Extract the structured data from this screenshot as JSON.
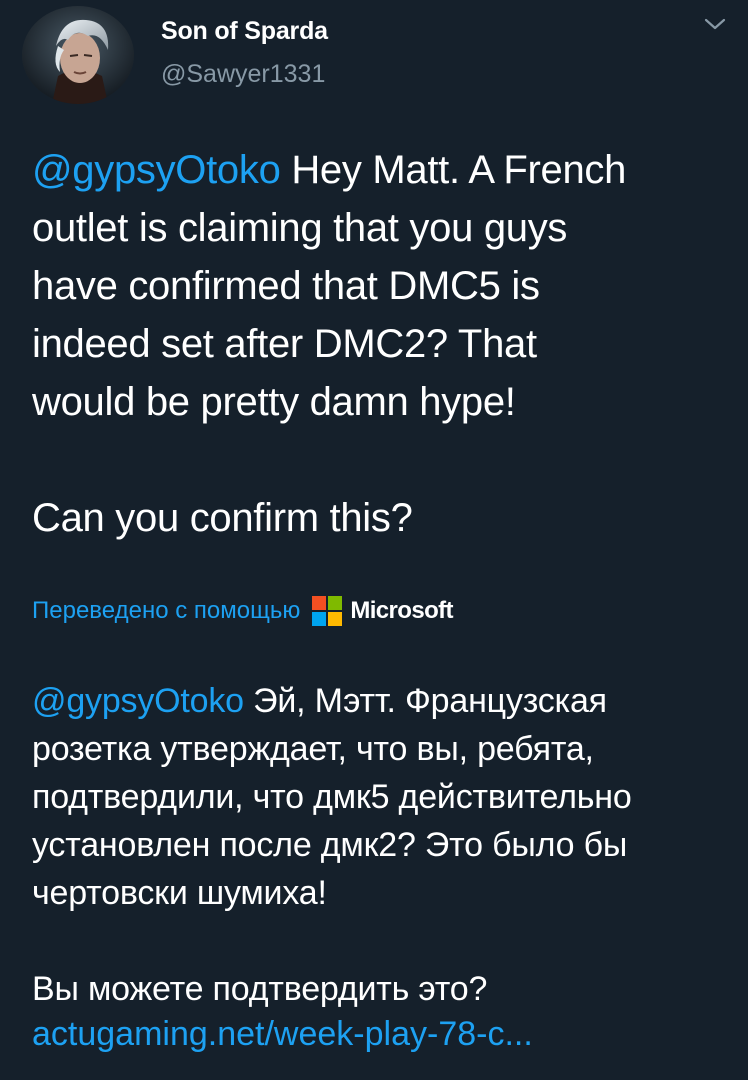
{
  "user": {
    "display_name": "Son of Sparda",
    "handle": "@Sawyer1331"
  },
  "icons": {
    "avatar": "avatar",
    "menu": "chevron-down-icon",
    "translator_logo": "microsoft-logo"
  },
  "tweet": {
    "lines": [
      {
        "mention": "@gypsyOtoko",
        "text": " Hey Matt. A French"
      },
      {
        "text": "outlet is claiming that you guys"
      },
      {
        "text": "have confirmed that DMC5 is"
      },
      {
        "text": "indeed set after DMC2? That"
      },
      {
        "text": "would be pretty damn hype!"
      },
      {
        "text": "Can you confirm this?"
      }
    ]
  },
  "translation_bar": {
    "label": "Переведено с помощью",
    "provider": "Microsoft",
    "logo_colors": [
      "#f25022",
      "#7fba00",
      "#00a4ef",
      "#ffb900"
    ]
  },
  "translation": {
    "lines": [
      {
        "mention": "@gypsyOtoko",
        "text": " Эй, Мэтт. Французская"
      },
      {
        "text": "розетка утверждает, что вы, ребята,"
      },
      {
        "text": "подтвердили, что дмк5 действительно"
      },
      {
        "text": "установлен после дмк2? Это было бы"
      },
      {
        "text": "чертовски шумиха!"
      },
      {
        "text": "Вы можете подтвердить это?"
      }
    ],
    "link": "actugaming.net/week-play-78-c..."
  },
  "colors": {
    "background": "#15202b",
    "accent": "#1da1f2",
    "secondary_text": "#8899a6",
    "primary_text": "#ffffff"
  }
}
